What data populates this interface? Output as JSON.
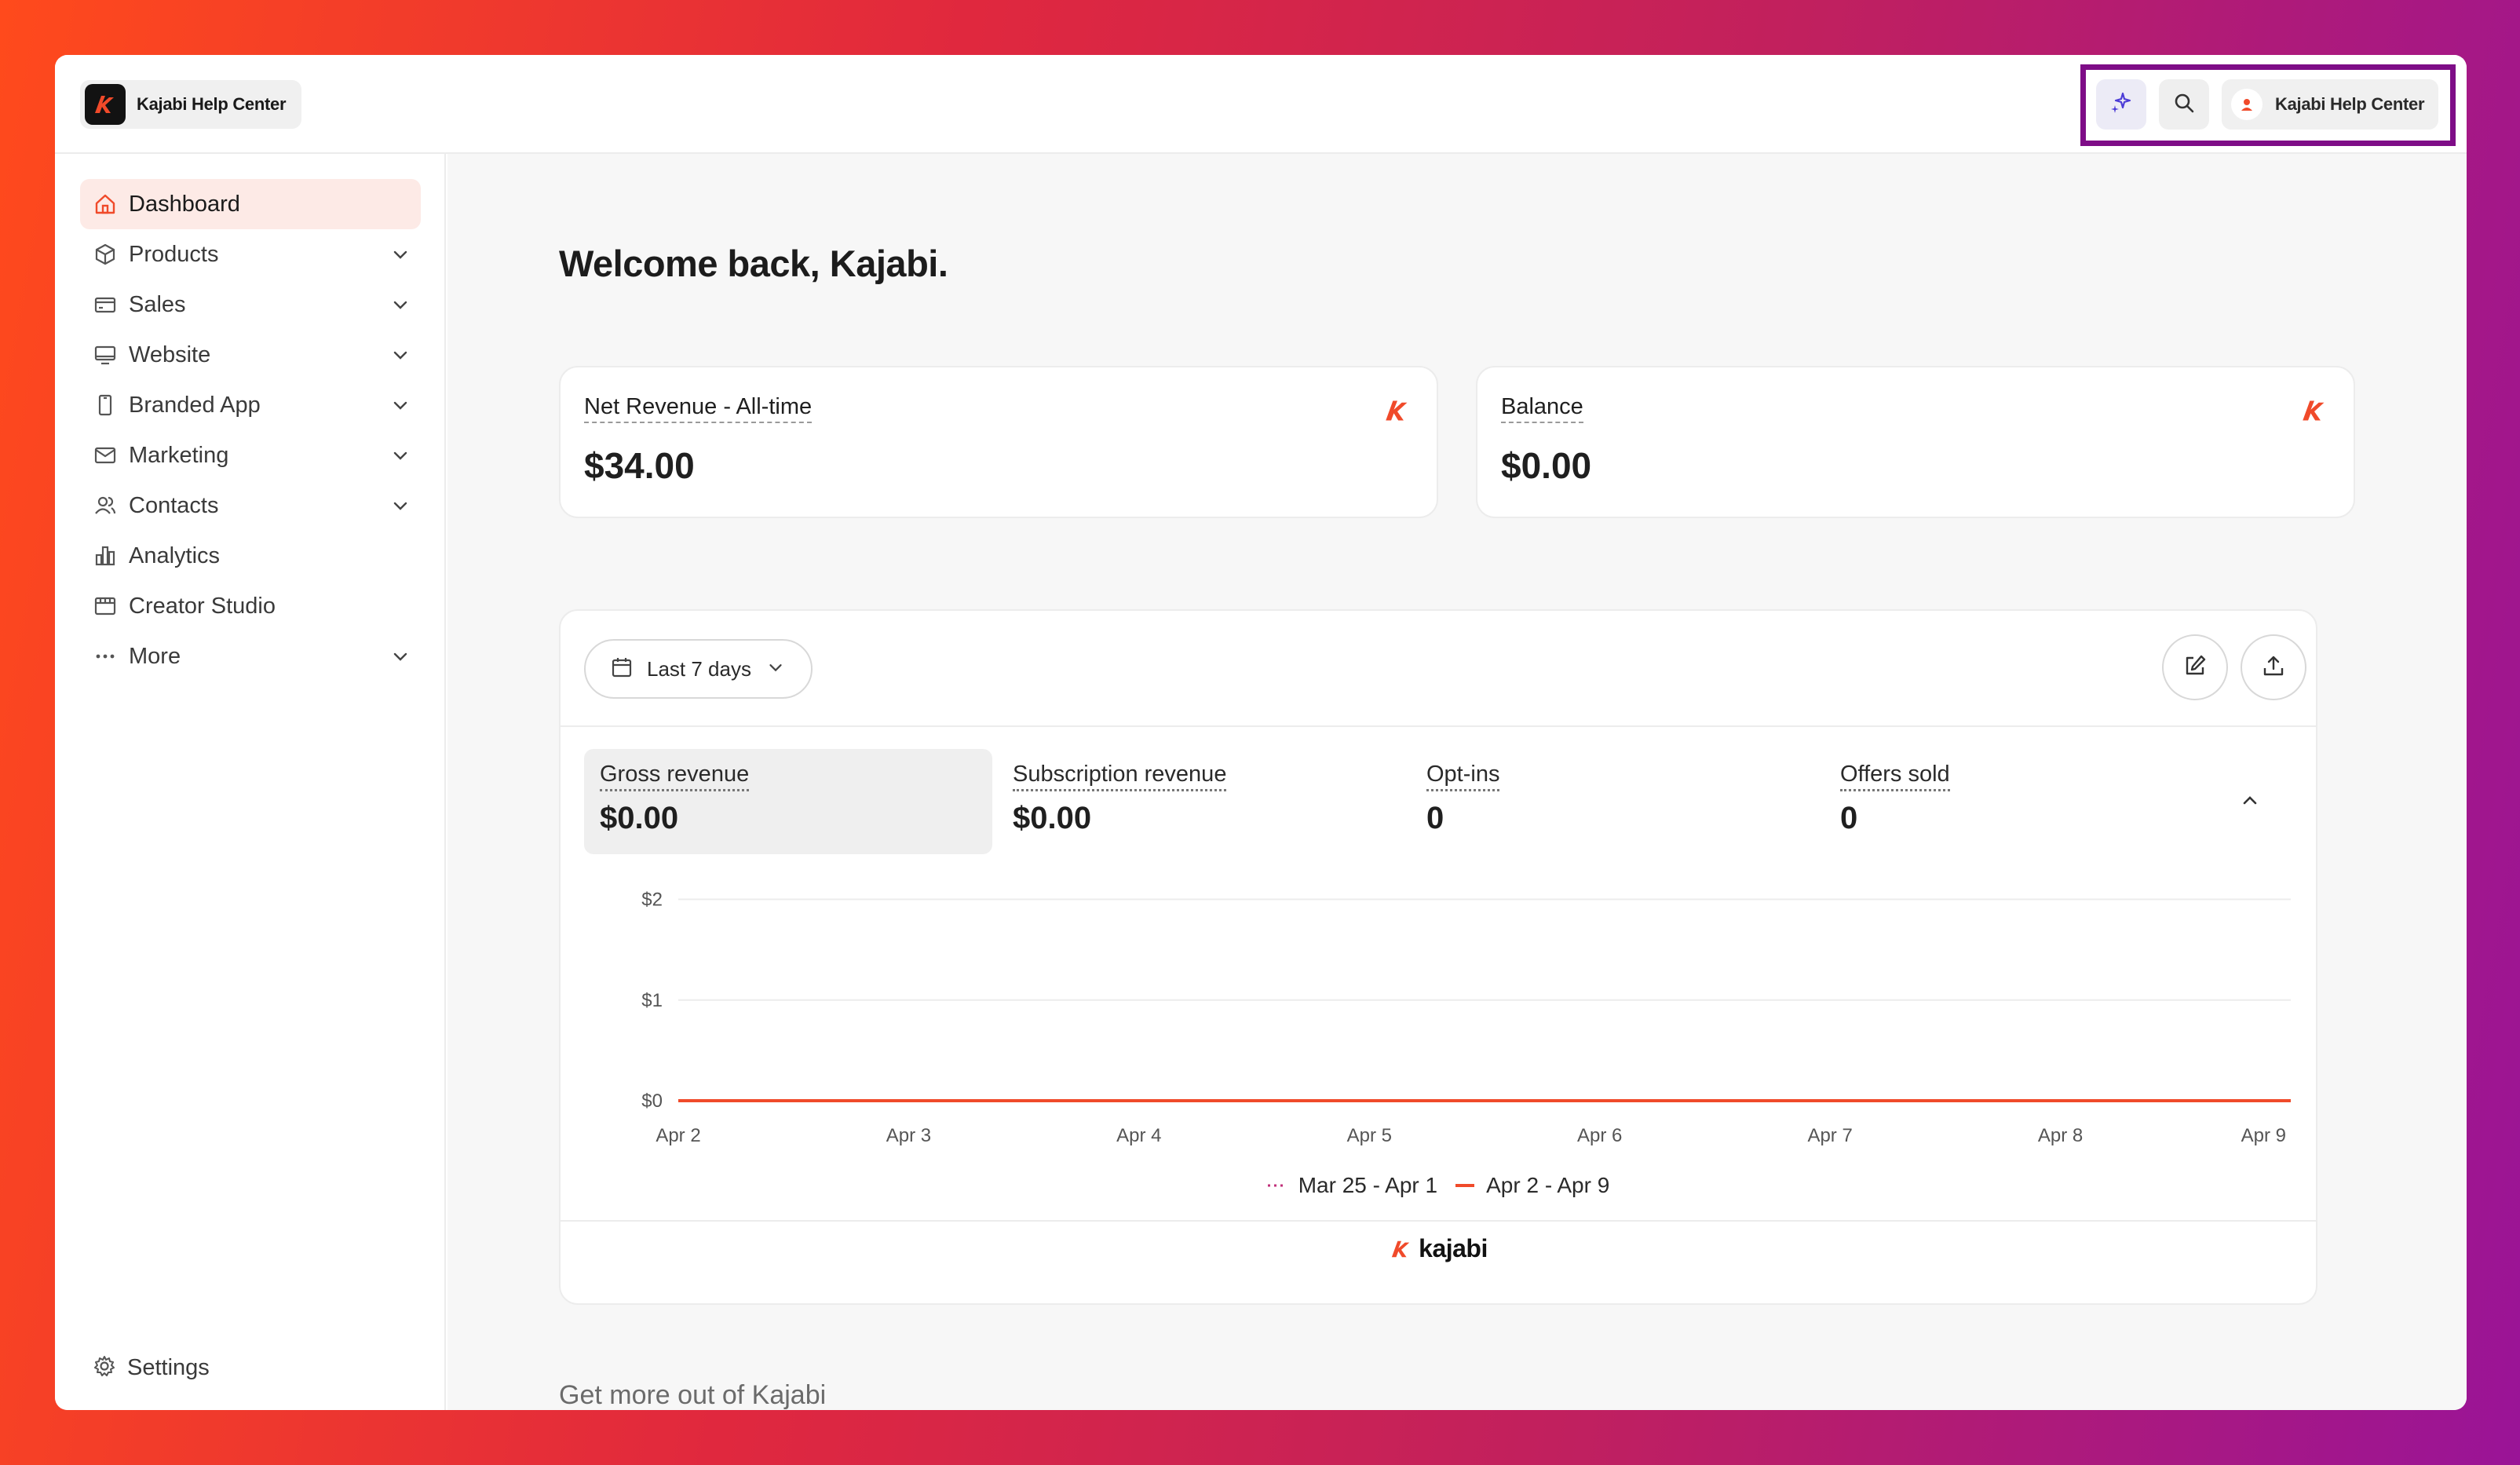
{
  "app": {
    "brand_name": "Kajabi Help Center"
  },
  "topbar": {
    "user_name": "Kajabi Help Center",
    "ai_icon": "sparkle-icon",
    "search_icon": "search-icon"
  },
  "sidebar": {
    "items": [
      {
        "label": "Dashboard",
        "icon": "home-icon",
        "active": true,
        "expandable": false
      },
      {
        "label": "Products",
        "icon": "box-icon",
        "expandable": true
      },
      {
        "label": "Sales",
        "icon": "credit-card-icon",
        "expandable": true
      },
      {
        "label": "Website",
        "icon": "monitor-icon",
        "expandable": true
      },
      {
        "label": "Branded App",
        "icon": "phone-icon",
        "expandable": true
      },
      {
        "label": "Marketing",
        "icon": "mail-icon",
        "expandable": true
      },
      {
        "label": "Contacts",
        "icon": "users-icon",
        "expandable": true
      },
      {
        "label": "Analytics",
        "icon": "bar-chart-icon",
        "expandable": false
      },
      {
        "label": "Creator Studio",
        "icon": "film-icon",
        "expandable": false
      },
      {
        "label": "More",
        "icon": "ellipsis-icon",
        "expandable": true
      }
    ],
    "settings_label": "Settings"
  },
  "main": {
    "welcome": "Welcome back, Kajabi.",
    "net_revenue": {
      "title": "Net Revenue - All-time",
      "value": "$34.00"
    },
    "balance": {
      "title": "Balance",
      "value": "$0.00"
    },
    "date_range": "Last 7 days",
    "metrics": [
      {
        "label": "Gross revenue",
        "value": "$0.00",
        "selected": true
      },
      {
        "label": "Subscription revenue",
        "value": "$0.00"
      },
      {
        "label": "Opt-ins",
        "value": "0"
      },
      {
        "label": "Offers sold",
        "value": "0"
      }
    ],
    "footer_brand": "kajabi",
    "more_title": "Get more out of Kajabi"
  },
  "chart_data": {
    "type": "line",
    "x": [
      "Apr 2",
      "Apr 3",
      "Apr 4",
      "Apr 5",
      "Apr 6",
      "Apr 7",
      "Apr 8",
      "Apr 9"
    ],
    "y_ticks": [
      "$2",
      "$1",
      "$0"
    ],
    "ylim": [
      0,
      2
    ],
    "series": [
      {
        "name": "Mar 25 - Apr 1",
        "values": [
          0,
          0,
          0,
          0,
          0,
          0,
          0,
          0
        ],
        "style": "dotted",
        "color": "#c1307a"
      },
      {
        "name": "Apr 2 - Apr 9",
        "values": [
          0,
          0,
          0,
          0,
          0,
          0,
          0,
          0
        ],
        "style": "solid",
        "color": "#f04a2a"
      }
    ],
    "grid": true,
    "legend": "bottom-center"
  }
}
